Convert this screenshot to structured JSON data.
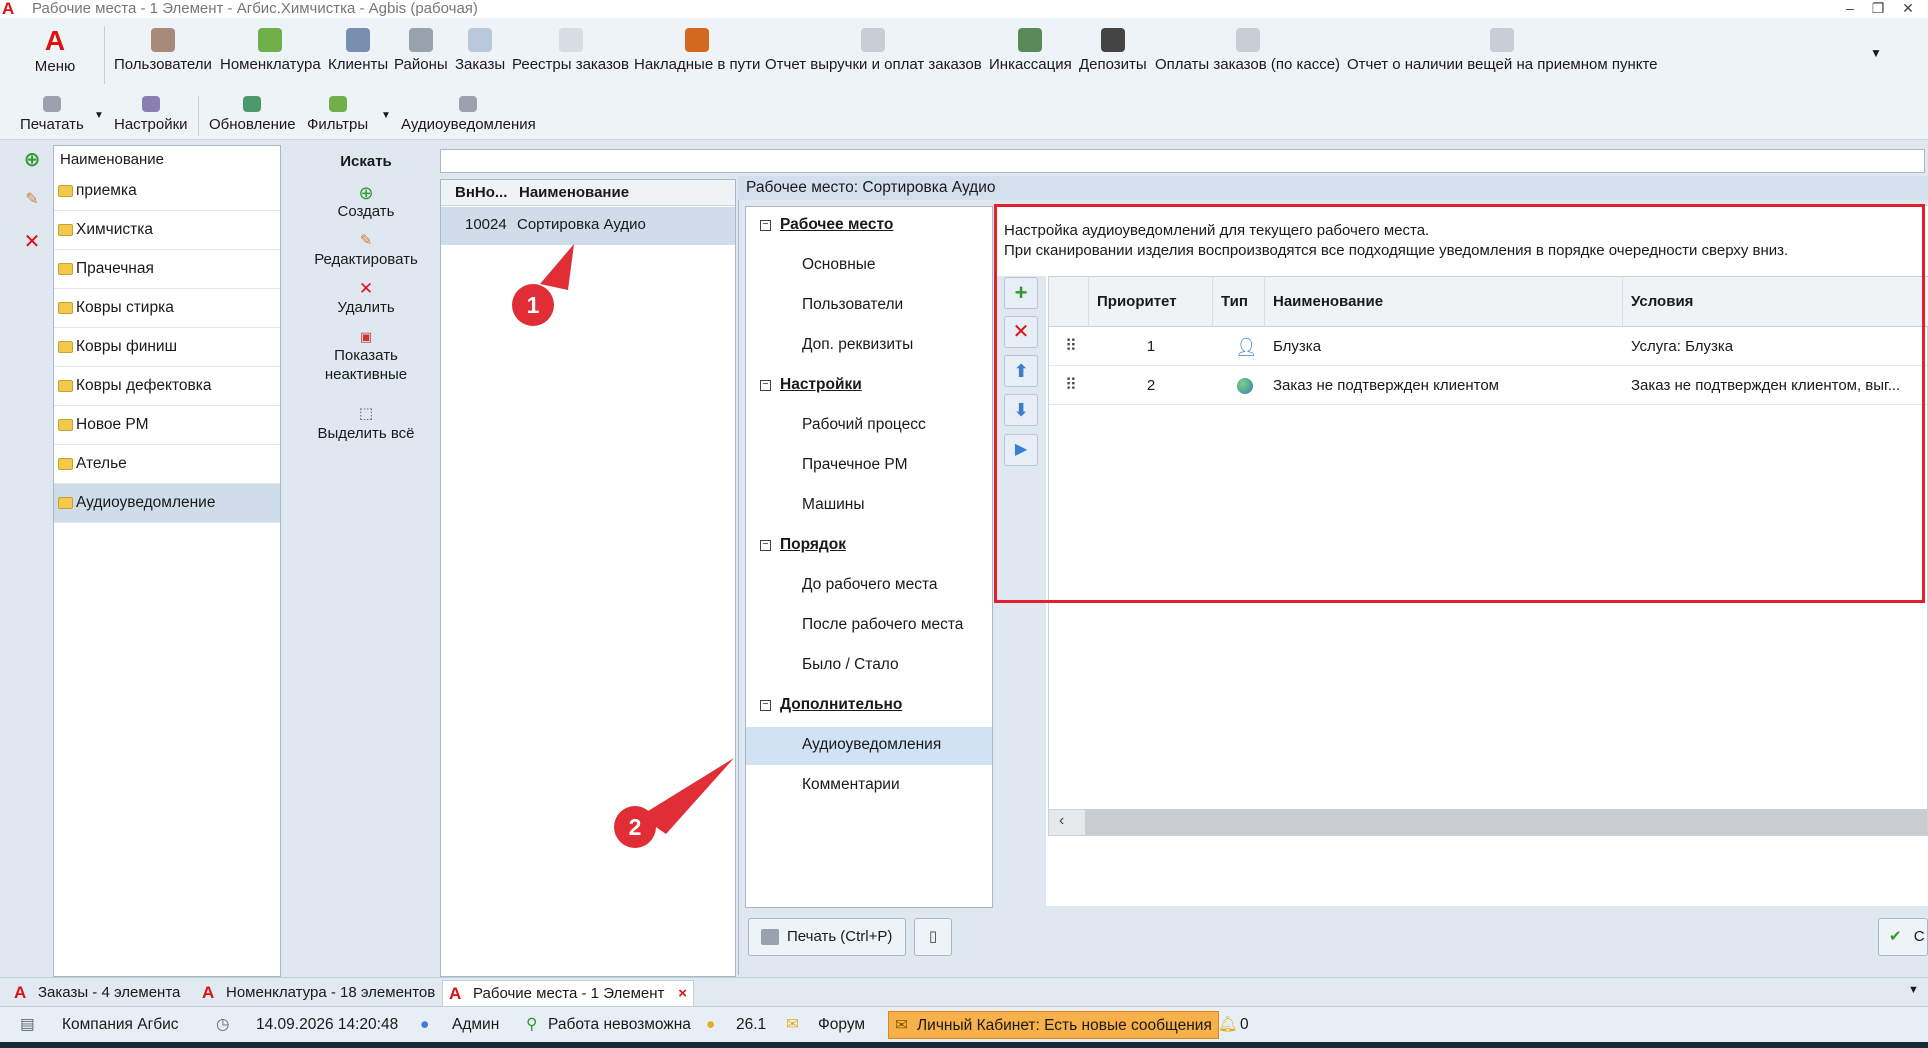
{
  "window": {
    "title": "Рабочие места - 1 Элемент - Агбис.Химчистка - Agbis (рабочая)",
    "logo_letter": "A"
  },
  "ribbon": {
    "menu_label": "Меню",
    "top_items": [
      {
        "label": "Пользователи",
        "icon": "users-icon"
      },
      {
        "label": "Номенклатура",
        "icon": "nomenclature-icon"
      },
      {
        "label": "Клиенты",
        "icon": "client-icon"
      },
      {
        "label": "Районы",
        "icon": "district-icon"
      },
      {
        "label": "Заказы",
        "icon": "orders-icon"
      },
      {
        "label": "Реестры заказов",
        "icon": "registry-icon"
      },
      {
        "label": "Накладные в пути",
        "icon": "truck-icon"
      },
      {
        "label": "Отчет выручки и оплат заказов",
        "icon": "report-icon"
      },
      {
        "label": "Инкассация",
        "icon": "cash-icon"
      },
      {
        "label": "Депозиты",
        "icon": "deposit-icon"
      },
      {
        "label": "Оплаты заказов (по кассе)",
        "icon": "payment-icon"
      },
      {
        "label": "Отчет о наличии вещей на приемном пункте",
        "icon": "inventory-report-icon"
      }
    ],
    "second_items": [
      {
        "label": "Печатать",
        "icon": "printer-icon"
      },
      {
        "label": "Настройки",
        "icon": "settings-icon"
      },
      {
        "label": "Обновление",
        "icon": "refresh-icon"
      },
      {
        "label": "Фильтры",
        "icon": "filter-icon"
      },
      {
        "label": "Аудиоуведомления",
        "icon": "megaphone-icon"
      }
    ]
  },
  "groups": {
    "header": "Наименование",
    "items": [
      "приемка",
      "Химчистка",
      "Прачечная",
      "Ковры стирка",
      "Ковры финиш",
      "Ковры дефектовка",
      "Новое РМ",
      "Ателье",
      "Аудиоуведомление"
    ],
    "selected_index": 8
  },
  "actions": {
    "search": "Искать",
    "create": "Создать",
    "edit": "Редактировать",
    "delete": "Удалить",
    "show_inactive": "Показать неактивные",
    "select_all": "Выделить всё"
  },
  "workplaces": {
    "col_id": "ВнНо...",
    "col_name": "Наименование",
    "rows": [
      {
        "id": "10024",
        "name": "Сортировка Аудио"
      }
    ]
  },
  "dialog": {
    "title": "Рабочее место: Сортировка Аудио",
    "nav": [
      {
        "section": "Рабочее место",
        "items": [
          "Основные",
          "Пользователи",
          "Доп. реквизиты"
        ]
      },
      {
        "section": "Настройки",
        "items": [
          "Рабочий процесс",
          "Прачечное РМ",
          "Машины"
        ]
      },
      {
        "section": "Порядок",
        "items": [
          "До рабочего места",
          "После рабочего места",
          "Было / Стало"
        ]
      },
      {
        "section": "Дополнительно",
        "items": [
          "Аудиоуведомления",
          "Комментарии"
        ]
      }
    ],
    "selected_nav": "Аудиоуведомления",
    "description_line1": "Настройка аудиоуведомлений для текущего рабочего места.",
    "description_line2": "При сканировании изделия воспроизводятся все подходящие уведомления в порядке очередности сверху вниз.",
    "table": {
      "headers": {
        "priority": "Приоритет",
        "type": "Тип",
        "name": "Наименование",
        "conditions": "Условия"
      },
      "rows": [
        {
          "priority": "1",
          "type_icon": "person-icon",
          "name": "Блузка",
          "conditions": "Услуга: Блузка"
        },
        {
          "priority": "2",
          "type_icon": "globe-icon",
          "name": "Заказ не подтвержден клиентом",
          "conditions": "Заказ не подтвержден клиентом, выг..."
        }
      ]
    },
    "print_button": "Печать (Ctrl+P)",
    "ok_button": "С"
  },
  "markers": [
    "1",
    "2"
  ],
  "tabs": [
    {
      "label": "Заказы - 4 элемента"
    },
    {
      "label": "Номенклатура - 18 элементов"
    },
    {
      "label": "Рабочие места - 1 Элемент",
      "active": true
    }
  ],
  "status": {
    "company": "Компания Агбис",
    "datetime": "14.09.2026 14:20:48",
    "user": "Админ",
    "work_state": "Работа невозможна",
    "coins": "26.1",
    "forum": "Форум",
    "cabinet": "Личный Кабинет: Есть новые сообщения",
    "bell_count": "0"
  },
  "colors": {
    "accent_red": "#e5202e",
    "selection": "#cfdcea",
    "ribbon_bg": "#eef3f8"
  }
}
